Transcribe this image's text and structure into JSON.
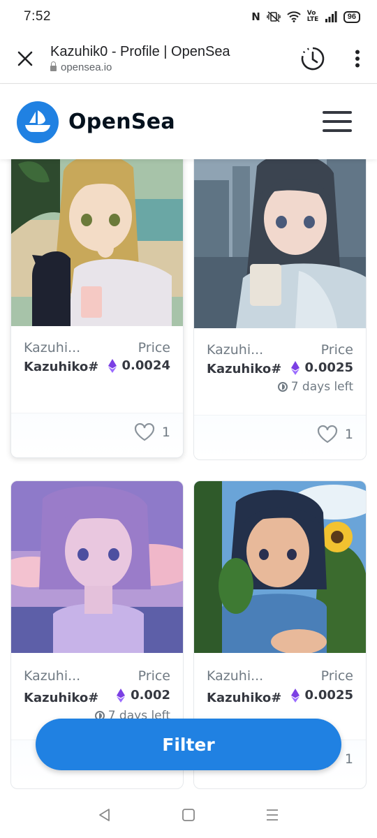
{
  "status_bar": {
    "time": "7:52",
    "nfc": "N",
    "volte": "Vo LTE",
    "battery": "96"
  },
  "tab_bar": {
    "title": "Kazuhik0 - Profile | OpenSea",
    "url": "opensea.io"
  },
  "header": {
    "brand": "OpenSea",
    "brand_color": "#2081e2"
  },
  "cards": [
    {
      "collection": "Kazuhi...",
      "name": "Kazuhiko#",
      "price_label": "Price",
      "price": "0.0024",
      "time_left": "",
      "likes": "1"
    },
    {
      "collection": "Kazuhi...",
      "name": "Kazuhiko#",
      "price_label": "Price",
      "price": "0.0025",
      "time_left": "7 days left",
      "likes": "1"
    },
    {
      "collection": "Kazuhi...",
      "name": "Kazuhiko#",
      "price_label": "Price",
      "price": "0.002",
      "time_left": "7 days left",
      "likes": ""
    },
    {
      "collection": "Kazuhi...",
      "name": "Kazuhiko#",
      "price_label": "Price",
      "price": "0.0025",
      "time_left": "",
      "likes": "1"
    }
  ],
  "filter": {
    "label": "Filter"
  }
}
